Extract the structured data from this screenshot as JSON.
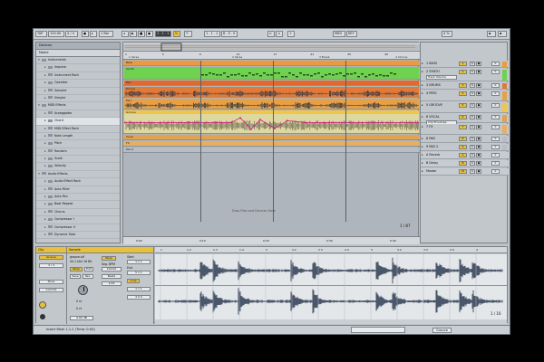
{
  "toolbar": {
    "tempo": "120.00",
    "time_sig": "4 / 4",
    "quantize": "1 Bar",
    "position": "1 . 1 . 1",
    "loop_start": "1 . 1 . 1",
    "loop_len": "8 . 0 . 0",
    "midi_label": "MIDI",
    "key_label": "KEY",
    "cpu": "4 %"
  },
  "browser": {
    "title": "Devices",
    "column": "Name",
    "rows": [
      {
        "label": "Instruments",
        "level": 0,
        "open": true
      },
      {
        "label": "Impulse",
        "level": 1
      },
      {
        "label": "Instrument Rack",
        "level": 1
      },
      {
        "label": "Operator",
        "level": 1
      },
      {
        "label": "Sampler",
        "level": 1
      },
      {
        "label": "Simpler",
        "level": 1
      },
      {
        "label": "MIDI Effects",
        "level": 0,
        "open": true
      },
      {
        "label": "Arpeggiator",
        "level": 1
      },
      {
        "label": "Chord",
        "level": 1
      },
      {
        "label": "MIDI Effect Rack",
        "level": 1
      },
      {
        "label": "Note Length",
        "level": 1
      },
      {
        "label": "Pitch",
        "level": 1
      },
      {
        "label": "Random",
        "level": 1
      },
      {
        "label": "Scale",
        "level": 1
      },
      {
        "label": "Velocity",
        "level": 1
      },
      {
        "label": "Audio Effects",
        "level": 0,
        "open": true
      },
      {
        "label": "Audio Effect Rack",
        "level": 1
      },
      {
        "label": "Auto Filter",
        "level": 1
      },
      {
        "label": "Auto Pan",
        "level": 1
      },
      {
        "label": "Beat Repeat",
        "level": 1
      },
      {
        "label": "Chorus",
        "level": 1
      },
      {
        "label": "Compressor I",
        "level": 1
      },
      {
        "label": "Compressor II",
        "level": 1
      },
      {
        "label": "Dynamic Tube",
        "level": 1
      }
    ]
  },
  "arrangement": {
    "markers": [
      "1 Verse",
      "2 Verse",
      "3 Break",
      "4 Chorus"
    ],
    "ruler_ticks": [
      "1",
      "5",
      "9",
      "13",
      "17",
      "21",
      "25",
      "29"
    ],
    "bottom_ticks": [
      "0:00",
      "0:10",
      "0:20",
      "0:30",
      "0:40"
    ],
    "hint": "Drop Files and Devices Here",
    "zoom": "1 / 87",
    "lanes": [
      {
        "name": "Bass",
        "color": "#ee9a3c",
        "wave": "none"
      },
      {
        "name": "Synth",
        "color": "#6ed24f",
        "wave": "midi"
      },
      {
        "name": "Pad",
        "color": "#e06a2c",
        "wave": "none"
      },
      {
        "name": "Drums",
        "color": "#e07a36",
        "wave": "audio"
      },
      {
        "name": "Perc",
        "color": "#e8a046",
        "wave": "audio"
      },
      {
        "name": "Groove",
        "color": "#f0c646",
        "wave": "auto"
      },
      {
        "name": "Vocal",
        "color": "#e2a24e",
        "wave": "none"
      },
      {
        "name": "FX",
        "color": "#e8b05e",
        "wave": "none"
      },
      {
        "name": "Pad 2",
        "color": "#b6bdc4",
        "wave": "none"
      }
    ]
  },
  "mixer": {
    "rows": [
      {
        "name": "1 BASS",
        "num": "1",
        "val": "0"
      },
      {
        "name": "2 SYNTH",
        "num": "2",
        "val": "0"
      },
      {
        "name": "3 DRUMS",
        "num": "3",
        "val": "0"
      },
      {
        "name": "4 PERC",
        "num": "4",
        "val": "0"
      },
      {
        "name": "5 GROOVE",
        "num": "5",
        "val": "0"
      },
      {
        "name": "6 VOCAL",
        "num": "6",
        "val": "0"
      },
      {
        "name": "7 FX",
        "num": "7",
        "val": "0"
      },
      {
        "name": "8 PAD",
        "num": "8",
        "val": "0"
      },
      {
        "name": "9 PAD 2",
        "num": "9",
        "val": "0"
      },
      {
        "name": "A Reverb",
        "num": "A",
        "val": "0"
      },
      {
        "name": "B Delay",
        "num": "B",
        "val": "0"
      },
      {
        "name": "Master",
        "num": "M",
        "val": "0"
      }
    ],
    "dropdowns": [
      "Track Volume",
      "Clip Envelope"
    ]
  },
  "clip_panel": {
    "tab": "Clip",
    "name": "Groove",
    "signature": "4 / 4",
    "groove": "None",
    "commit": "Commit"
  },
  "sample_panel": {
    "tab": "Sample",
    "file": "groove.aif",
    "rate": "44.1 kHz 16 Bit",
    "warp": "Warp",
    "start": "Start",
    "end": "End",
    "loop": "Loop",
    "seg_bpm": "Seg. BPM",
    "bpm_value": "120.00",
    "mode": "Beats",
    "transients": "1/16",
    "transpose": "0 st",
    "detune": "0 ct",
    "gain": "0.00 dB"
  },
  "wave_editor": {
    "ticks": [
      "1",
      "1.2",
      "1.3",
      "1.4",
      "2",
      "2.2",
      "2.3",
      "2.4",
      "3",
      "3.2",
      "3.3",
      "3.4",
      "4"
    ],
    "zoom": "1 / 16"
  },
  "status": {
    "info": "Insert Mark 1.1.1 (Time: 0:00)",
    "device": "Groove"
  }
}
